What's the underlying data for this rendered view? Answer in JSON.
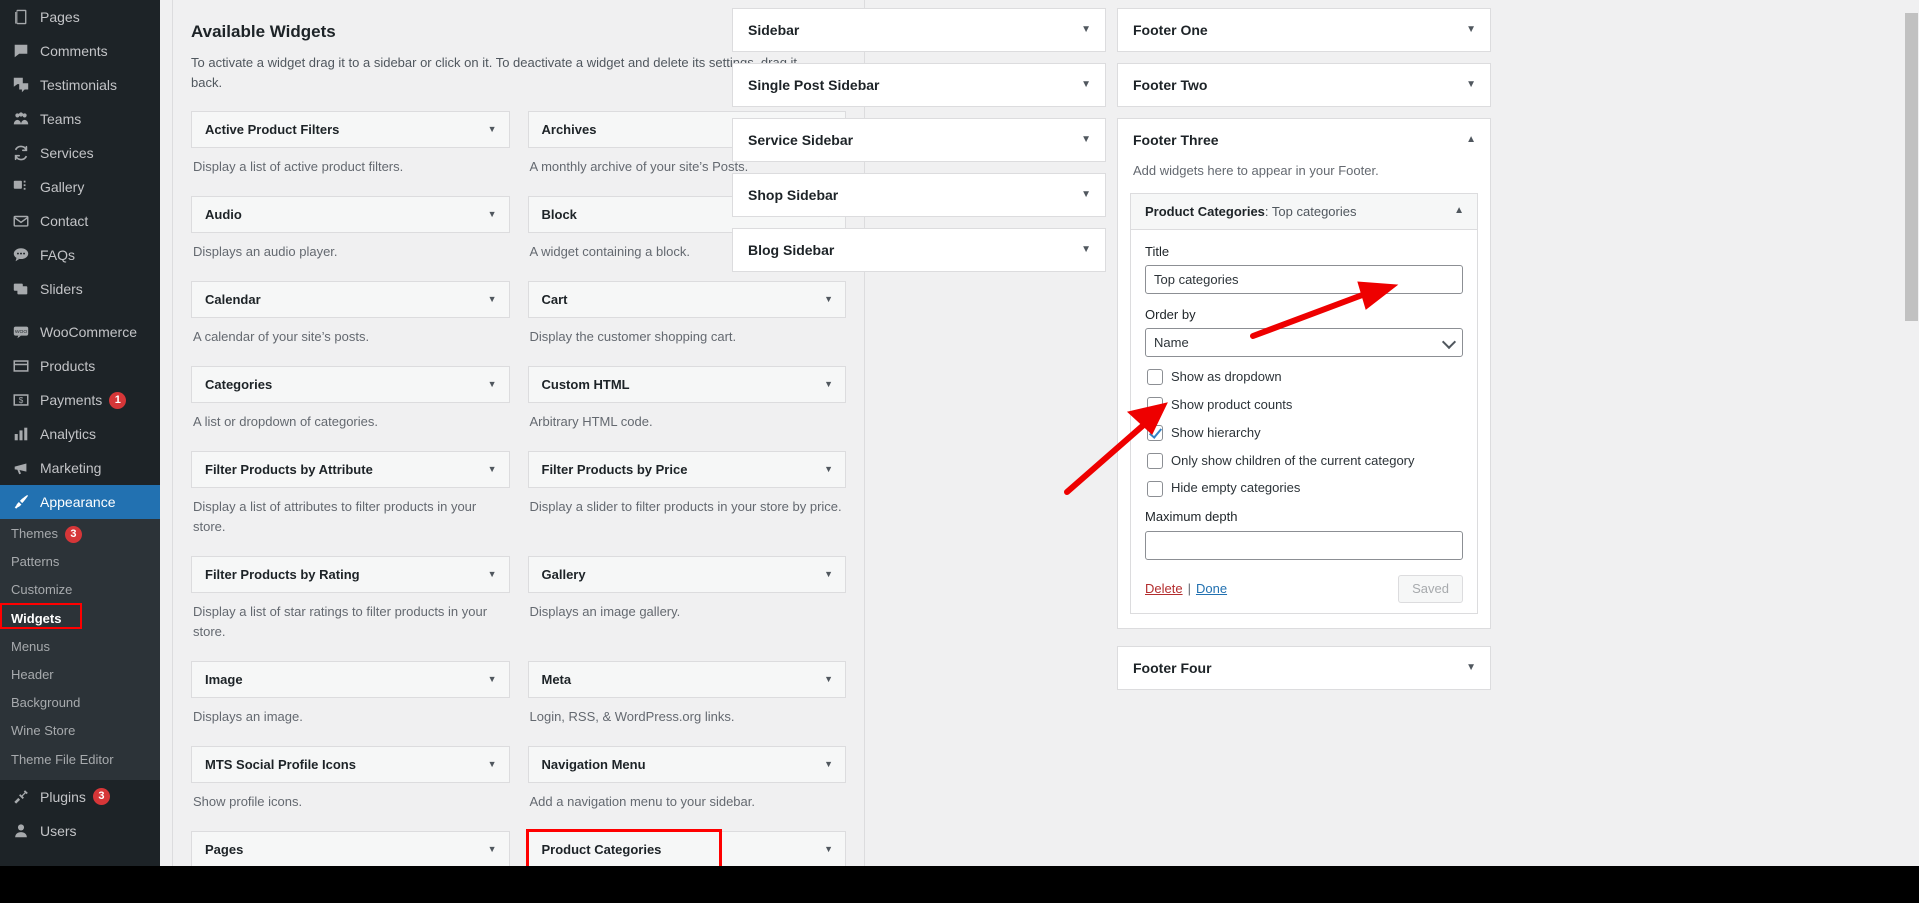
{
  "admin_menu": {
    "items": [
      {
        "label": "Pages",
        "icon": "pages-icon"
      },
      {
        "label": "Comments",
        "icon": "comments-icon"
      },
      {
        "label": "Testimonials",
        "icon": "testimonials-icon"
      },
      {
        "label": "Teams",
        "icon": "teams-icon"
      },
      {
        "label": "Services",
        "icon": "services-icon"
      },
      {
        "label": "Gallery",
        "icon": "gallery-icon"
      },
      {
        "label": "Contact",
        "icon": "contact-icon"
      },
      {
        "label": "FAQs",
        "icon": "faqs-icon"
      },
      {
        "label": "Sliders",
        "icon": "sliders-icon"
      }
    ],
    "items2": [
      {
        "label": "WooCommerce",
        "icon": "woocommerce-icon"
      },
      {
        "label": "Products",
        "icon": "products-icon"
      },
      {
        "label": "Payments",
        "icon": "payments-icon",
        "badge": "1"
      },
      {
        "label": "Analytics",
        "icon": "analytics-icon"
      },
      {
        "label": "Marketing",
        "icon": "marketing-icon"
      }
    ],
    "appearance": {
      "label": "Appearance",
      "icon": "appearance-icon"
    },
    "appearance_submenu": [
      {
        "label": "Themes",
        "badge": "3"
      },
      {
        "label": "Patterns"
      },
      {
        "label": "Customize"
      },
      {
        "label": "Widgets",
        "current": true
      },
      {
        "label": "Menus"
      },
      {
        "label": "Header"
      },
      {
        "label": "Background"
      },
      {
        "label": "Wine Store"
      },
      {
        "label": "Theme File Editor"
      }
    ],
    "items3": [
      {
        "label": "Plugins",
        "icon": "plugins-icon",
        "badge": "3"
      },
      {
        "label": "Users",
        "icon": "users-icon"
      }
    ]
  },
  "available": {
    "heading": "Available Widgets",
    "description": "To activate a widget drag it to a sidebar or click on it. To deactivate a widget and delete its settings, drag it back.",
    "toggle_icon": "chevron-down-icon",
    "widgets": [
      {
        "name": "Active Product Filters",
        "desc": "Display a list of active product filters."
      },
      {
        "name": "Archives",
        "desc": "A monthly archive of your site’s Posts."
      },
      {
        "name": "Audio",
        "desc": "Displays an audio player."
      },
      {
        "name": "Block",
        "desc": "A widget containing a block."
      },
      {
        "name": "Calendar",
        "desc": "A calendar of your site’s posts."
      },
      {
        "name": "Cart",
        "desc": "Display the customer shopping cart."
      },
      {
        "name": "Categories",
        "desc": "A list or dropdown of categories."
      },
      {
        "name": "Custom HTML",
        "desc": "Arbitrary HTML code."
      },
      {
        "name": "Filter Products by Attribute",
        "desc": "Display a list of attributes to filter products in your store.",
        "two": true
      },
      {
        "name": "Filter Products by Price",
        "desc": "Display a slider to filter products in your store by price.",
        "two": true
      },
      {
        "name": "Filter Products by Rating",
        "desc": "Display a list of star ratings to filter products in your store.",
        "two": true
      },
      {
        "name": "Gallery",
        "desc": "Displays an image gallery.",
        "two": true
      },
      {
        "name": "Image",
        "desc": "Displays an image."
      },
      {
        "name": "Meta",
        "desc": "Login, RSS, & WordPress.org links."
      },
      {
        "name": "MTS Social Profile Icons",
        "desc": "Show profile icons."
      },
      {
        "name": "Navigation Menu",
        "desc": "Add a navigation menu to your sidebar."
      },
      {
        "name": "Pages",
        "desc": ""
      },
      {
        "name": "Product Categories",
        "desc": "",
        "highlighted": true
      }
    ]
  },
  "sidebars": [
    {
      "name": "Sidebar",
      "toggle_icon": "chevron-down-icon"
    },
    {
      "name": "Single Post Sidebar",
      "toggle_icon": "chevron-down-icon"
    },
    {
      "name": "Service Sidebar",
      "toggle_icon": "chevron-down-icon"
    },
    {
      "name": "Shop Sidebar",
      "toggle_icon": "chevron-down-icon"
    },
    {
      "name": "Blog Sidebar",
      "toggle_icon": "chevron-down-icon"
    }
  ],
  "footers": {
    "footer_one": {
      "name": "Footer One",
      "toggle_icon": "chevron-down-icon"
    },
    "footer_two": {
      "name": "Footer Two",
      "toggle_icon": "chevron-down-icon"
    },
    "footer_three": {
      "name": "Footer Three",
      "toggle_icon": "chevron-up-icon",
      "hint": "Add widgets here to appear in your Footer.",
      "widget": {
        "type": "Product Categories",
        "separator": ": ",
        "instance_title": "Top categories",
        "toggle_icon": "chevron-up-icon",
        "title_label": "Title",
        "title_value": "Top categories",
        "orderby_label": "Order by",
        "orderby_value": "Name",
        "orderby_caret": "chevron-down-icon",
        "checkboxes": [
          {
            "label": "Show as dropdown",
            "checked": false
          },
          {
            "label": "Show product counts",
            "checked": false
          },
          {
            "label": "Show hierarchy",
            "checked": true
          },
          {
            "label": "Only show children of the current category",
            "checked": false
          },
          {
            "label": "Hide empty categories",
            "checked": false
          }
        ],
        "maxdepth_label": "Maximum depth",
        "maxdepth_value": "",
        "delete_label": "Delete",
        "separator_pipe": "|",
        "done_label": "Done",
        "saved_label": "Saved"
      }
    },
    "footer_four": {
      "name": "Footer Four",
      "toggle_icon": "chevron-down-icon"
    }
  },
  "annotations": {
    "arrow_color": "#ee0000",
    "arrow_title_target": "Title field",
    "arrow_hierarchy_target": "Show hierarchy checkbox",
    "highlight_color": "#ff0000"
  }
}
